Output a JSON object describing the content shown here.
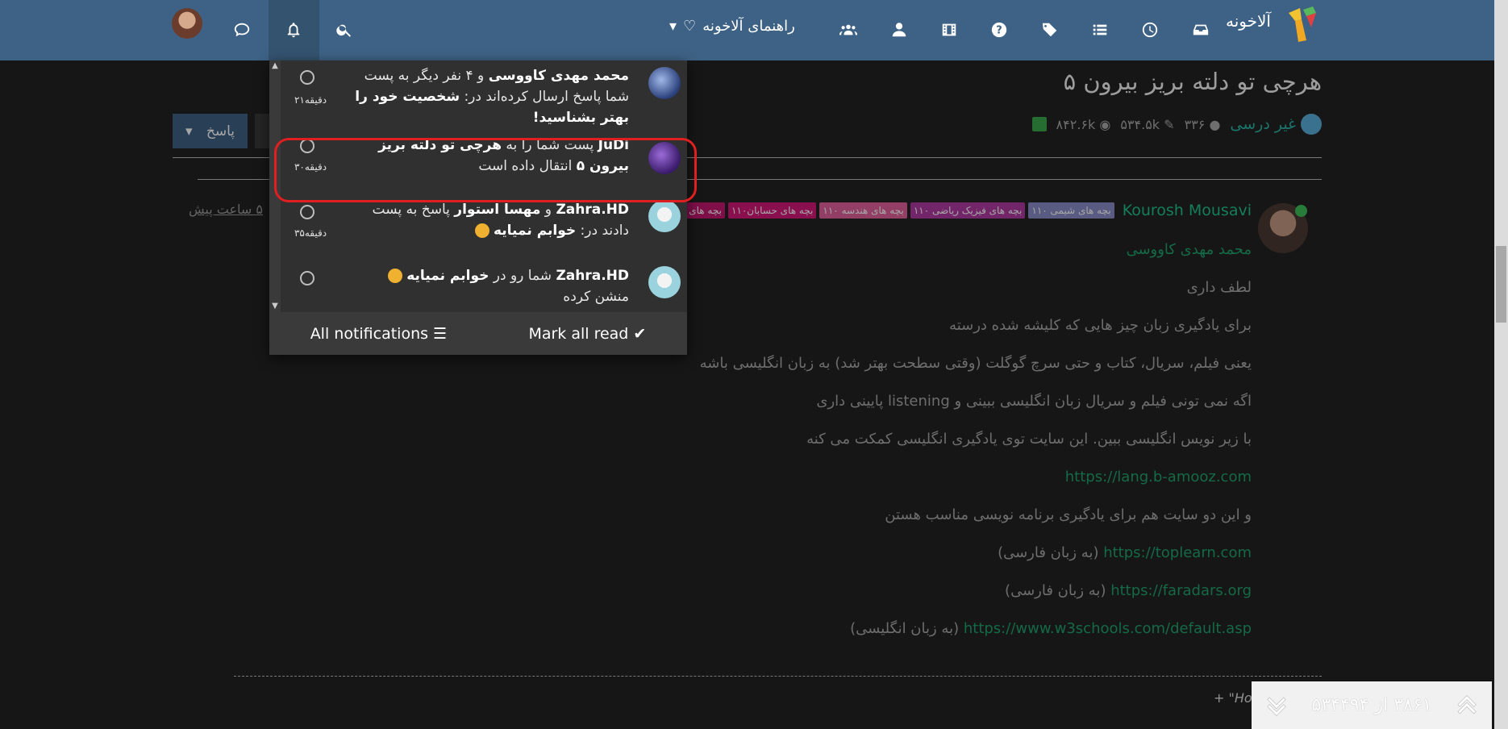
{
  "nav": {
    "brand": "آلاخونه",
    "guide_label": "راهنمای آلاخونه"
  },
  "topic": {
    "title": "هرچی تو دلته بریز بیرون ۵",
    "category": "غیر درسی",
    "posts": "۳۳۶",
    "views": "۵۳۴.۵k",
    "followers": "۸۴۲.۶k",
    "reply_label": "پاسخ",
    "time_ago": "۵ ساعت پیش"
  },
  "post": {
    "author": "Kourosh Mousavi",
    "tags": [
      {
        "label": "بچه های شیمی ۱۱۰",
        "color": "#8a8cc9"
      },
      {
        "label": "بچه های فیزیک ریاضی ۱۱۰",
        "color": "#b03aa0"
      },
      {
        "label": "بچه های هندسه ۱۱۰",
        "color": "#e0609c"
      },
      {
        "label": "بچه های حسابان۱۱۰",
        "color": "#d4187a"
      },
      {
        "label": "بچه های ریا",
        "color": "#c21870"
      }
    ],
    "quoted": "محمد مهدی کاووسی",
    "lines": [
      "لطف داری",
      "برای یادگیری زبان چیز هایی که کلیشه شده درسته",
      "یعنی فیلم، سریال، کتاب و حتی سرچ گوگلت (وقتی سطحت بهتر شد) به زبان انگلیسی باشه",
      "اگه نمی تونی فیلم و سریال زبان انگلیسی ببینی و listening پایینی داری",
      "با زیر نویس انگلیسی ببین. این سایت توی یادگیری انگلیسی کمکت می کنه"
    ],
    "link1": "https://lang.b-amooz.com",
    "line_sites": "و این دو سایت هم برای یادگیری برنامه نویسی مناسب هستن",
    "link2": "https://toplearn.com",
    "link2_note": "(به زبان فارسی)",
    "link3": "https://faradars.org",
    "link3_note": "(به زبان فارسی)",
    "link4": "https://www.w3schools.com/default.asp",
    "link4_note": "(به زبان انگلیسی)",
    "footer_quote": "+ \"How"
  },
  "pager": {
    "text": "۳۸۶۱ از ۵۳۴۴۹۴"
  },
  "notifications": {
    "items": [
      {
        "bold_user": "محمد مهدی کاووسی",
        "text_a": " و ۴ نفر دیگر به پست شما پاسخ ارسال کرده‌اند در: ",
        "bold_topic": "شخصیت خود را بهتر بشناسید!",
        "time": "۲۱دقیقه"
      },
      {
        "bold_user": "JuDi",
        "text_a": " پست شما را به ",
        "bold_topic": "هرچی تو دلته بریز بیرون ۵",
        "text_b": " انتقال داده است",
        "time": "۳۰دقیقه"
      },
      {
        "bold_user": "Zahra.HD",
        "text_a": " و ",
        "bold_user2": "مهسا استوار",
        "text_b": " پاسخ به پست دادند در: ",
        "bold_topic": "خوابم نمیایه",
        "time": "۳۵دقیقه"
      },
      {
        "bold_user": "Zahra.HD",
        "text_a": " شما رو در ",
        "bold_topic": "خوابم نمیایه",
        "text_b": " منشن کرده"
      }
    ],
    "all_label": "All notifications",
    "mark_label": "Mark all read"
  }
}
